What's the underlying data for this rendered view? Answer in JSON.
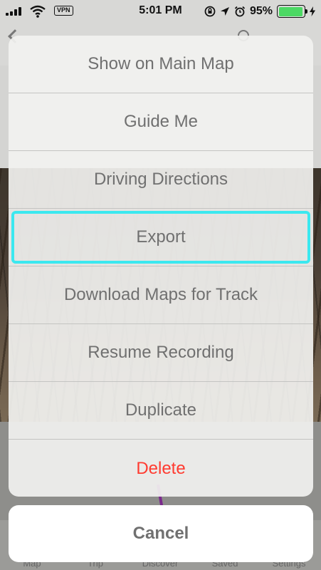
{
  "status_bar": {
    "vpn": "VPN",
    "time": "5:01 PM",
    "battery_percent": "95%",
    "battery_level": 0.95,
    "battery_color": "#4cd964"
  },
  "tab_bar": {
    "items": [
      {
        "label": "Map",
        "icon": "map-icon"
      },
      {
        "label": "Trip",
        "icon": "trip-icon"
      },
      {
        "label": "Discover",
        "icon": "discover-icon"
      },
      {
        "label": "Saved",
        "icon": "saved-icon"
      },
      {
        "label": "Settings",
        "icon": "settings-icon"
      }
    ]
  },
  "action_sheet": {
    "items": [
      {
        "label": "Show on Main Map"
      },
      {
        "label": "Guide Me"
      },
      {
        "label": "Driving Directions"
      },
      {
        "label": "Export",
        "highlighted": true
      },
      {
        "label": "Download Maps for Track"
      },
      {
        "label": "Resume Recording"
      },
      {
        "label": "Duplicate"
      },
      {
        "label": "Delete",
        "destructive": true,
        "color": "#ff3b30"
      }
    ],
    "cancel_label": "Cancel",
    "highlight_color": "#3be8ef"
  }
}
